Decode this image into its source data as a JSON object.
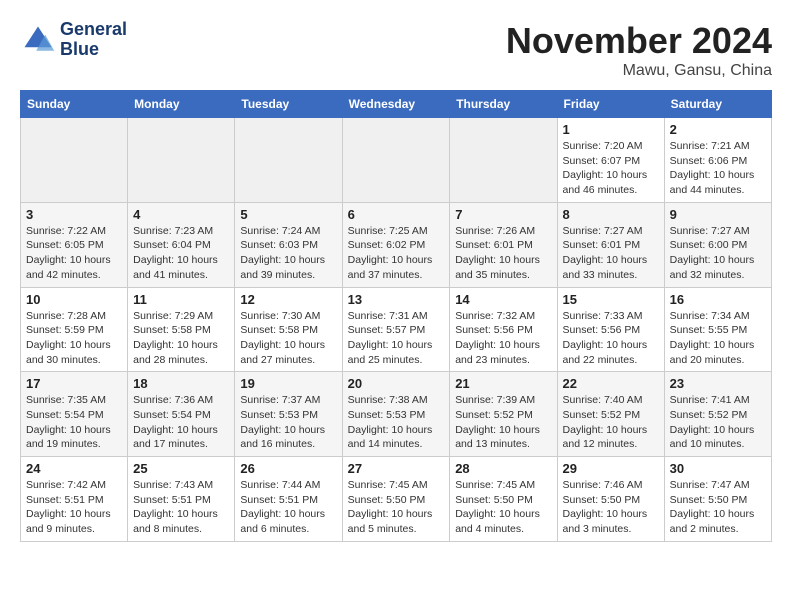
{
  "header": {
    "logo_line1": "General",
    "logo_line2": "Blue",
    "month": "November 2024",
    "location": "Mawu, Gansu, China"
  },
  "weekdays": [
    "Sunday",
    "Monday",
    "Tuesday",
    "Wednesday",
    "Thursday",
    "Friday",
    "Saturday"
  ],
  "weeks": [
    [
      {
        "day": "",
        "info": ""
      },
      {
        "day": "",
        "info": ""
      },
      {
        "day": "",
        "info": ""
      },
      {
        "day": "",
        "info": ""
      },
      {
        "day": "",
        "info": ""
      },
      {
        "day": "1",
        "info": "Sunrise: 7:20 AM\nSunset: 6:07 PM\nDaylight: 10 hours\nand 46 minutes."
      },
      {
        "day": "2",
        "info": "Sunrise: 7:21 AM\nSunset: 6:06 PM\nDaylight: 10 hours\nand 44 minutes."
      }
    ],
    [
      {
        "day": "3",
        "info": "Sunrise: 7:22 AM\nSunset: 6:05 PM\nDaylight: 10 hours\nand 42 minutes."
      },
      {
        "day": "4",
        "info": "Sunrise: 7:23 AM\nSunset: 6:04 PM\nDaylight: 10 hours\nand 41 minutes."
      },
      {
        "day": "5",
        "info": "Sunrise: 7:24 AM\nSunset: 6:03 PM\nDaylight: 10 hours\nand 39 minutes."
      },
      {
        "day": "6",
        "info": "Sunrise: 7:25 AM\nSunset: 6:02 PM\nDaylight: 10 hours\nand 37 minutes."
      },
      {
        "day": "7",
        "info": "Sunrise: 7:26 AM\nSunset: 6:01 PM\nDaylight: 10 hours\nand 35 minutes."
      },
      {
        "day": "8",
        "info": "Sunrise: 7:27 AM\nSunset: 6:01 PM\nDaylight: 10 hours\nand 33 minutes."
      },
      {
        "day": "9",
        "info": "Sunrise: 7:27 AM\nSunset: 6:00 PM\nDaylight: 10 hours\nand 32 minutes."
      }
    ],
    [
      {
        "day": "10",
        "info": "Sunrise: 7:28 AM\nSunset: 5:59 PM\nDaylight: 10 hours\nand 30 minutes."
      },
      {
        "day": "11",
        "info": "Sunrise: 7:29 AM\nSunset: 5:58 PM\nDaylight: 10 hours\nand 28 minutes."
      },
      {
        "day": "12",
        "info": "Sunrise: 7:30 AM\nSunset: 5:58 PM\nDaylight: 10 hours\nand 27 minutes."
      },
      {
        "day": "13",
        "info": "Sunrise: 7:31 AM\nSunset: 5:57 PM\nDaylight: 10 hours\nand 25 minutes."
      },
      {
        "day": "14",
        "info": "Sunrise: 7:32 AM\nSunset: 5:56 PM\nDaylight: 10 hours\nand 23 minutes."
      },
      {
        "day": "15",
        "info": "Sunrise: 7:33 AM\nSunset: 5:56 PM\nDaylight: 10 hours\nand 22 minutes."
      },
      {
        "day": "16",
        "info": "Sunrise: 7:34 AM\nSunset: 5:55 PM\nDaylight: 10 hours\nand 20 minutes."
      }
    ],
    [
      {
        "day": "17",
        "info": "Sunrise: 7:35 AM\nSunset: 5:54 PM\nDaylight: 10 hours\nand 19 minutes."
      },
      {
        "day": "18",
        "info": "Sunrise: 7:36 AM\nSunset: 5:54 PM\nDaylight: 10 hours\nand 17 minutes."
      },
      {
        "day": "19",
        "info": "Sunrise: 7:37 AM\nSunset: 5:53 PM\nDaylight: 10 hours\nand 16 minutes."
      },
      {
        "day": "20",
        "info": "Sunrise: 7:38 AM\nSunset: 5:53 PM\nDaylight: 10 hours\nand 14 minutes."
      },
      {
        "day": "21",
        "info": "Sunrise: 7:39 AM\nSunset: 5:52 PM\nDaylight: 10 hours\nand 13 minutes."
      },
      {
        "day": "22",
        "info": "Sunrise: 7:40 AM\nSunset: 5:52 PM\nDaylight: 10 hours\nand 12 minutes."
      },
      {
        "day": "23",
        "info": "Sunrise: 7:41 AM\nSunset: 5:52 PM\nDaylight: 10 hours\nand 10 minutes."
      }
    ],
    [
      {
        "day": "24",
        "info": "Sunrise: 7:42 AM\nSunset: 5:51 PM\nDaylight: 10 hours\nand 9 minutes."
      },
      {
        "day": "25",
        "info": "Sunrise: 7:43 AM\nSunset: 5:51 PM\nDaylight: 10 hours\nand 8 minutes."
      },
      {
        "day": "26",
        "info": "Sunrise: 7:44 AM\nSunset: 5:51 PM\nDaylight: 10 hours\nand 6 minutes."
      },
      {
        "day": "27",
        "info": "Sunrise: 7:45 AM\nSunset: 5:50 PM\nDaylight: 10 hours\nand 5 minutes."
      },
      {
        "day": "28",
        "info": "Sunrise: 7:45 AM\nSunset: 5:50 PM\nDaylight: 10 hours\nand 4 minutes."
      },
      {
        "day": "29",
        "info": "Sunrise: 7:46 AM\nSunset: 5:50 PM\nDaylight: 10 hours\nand 3 minutes."
      },
      {
        "day": "30",
        "info": "Sunrise: 7:47 AM\nSunset: 5:50 PM\nDaylight: 10 hours\nand 2 minutes."
      }
    ]
  ]
}
